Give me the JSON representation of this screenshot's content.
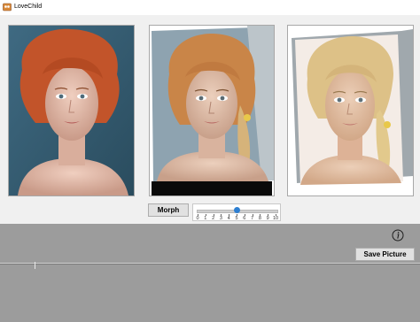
{
  "window": {
    "title": "LoveChild",
    "app_icon": "app-logo-icon"
  },
  "panels": [
    {
      "name": "source-face-left",
      "description_icon": "portrait-image"
    },
    {
      "name": "morph-result",
      "description_icon": "portrait-image"
    },
    {
      "name": "source-face-right",
      "description_icon": "portrait-image"
    }
  ],
  "controls": {
    "morph_label": "Morph",
    "save_label": "Save Picture",
    "info_icon": "info-icon"
  },
  "slider": {
    "min": 0,
    "max": 10,
    "value": 5,
    "tick_labels": [
      "0",
      "1",
      "2",
      "3",
      "4",
      "5",
      "6",
      "7",
      "8",
      "9",
      "10"
    ],
    "accent": "#2d7fd2"
  }
}
